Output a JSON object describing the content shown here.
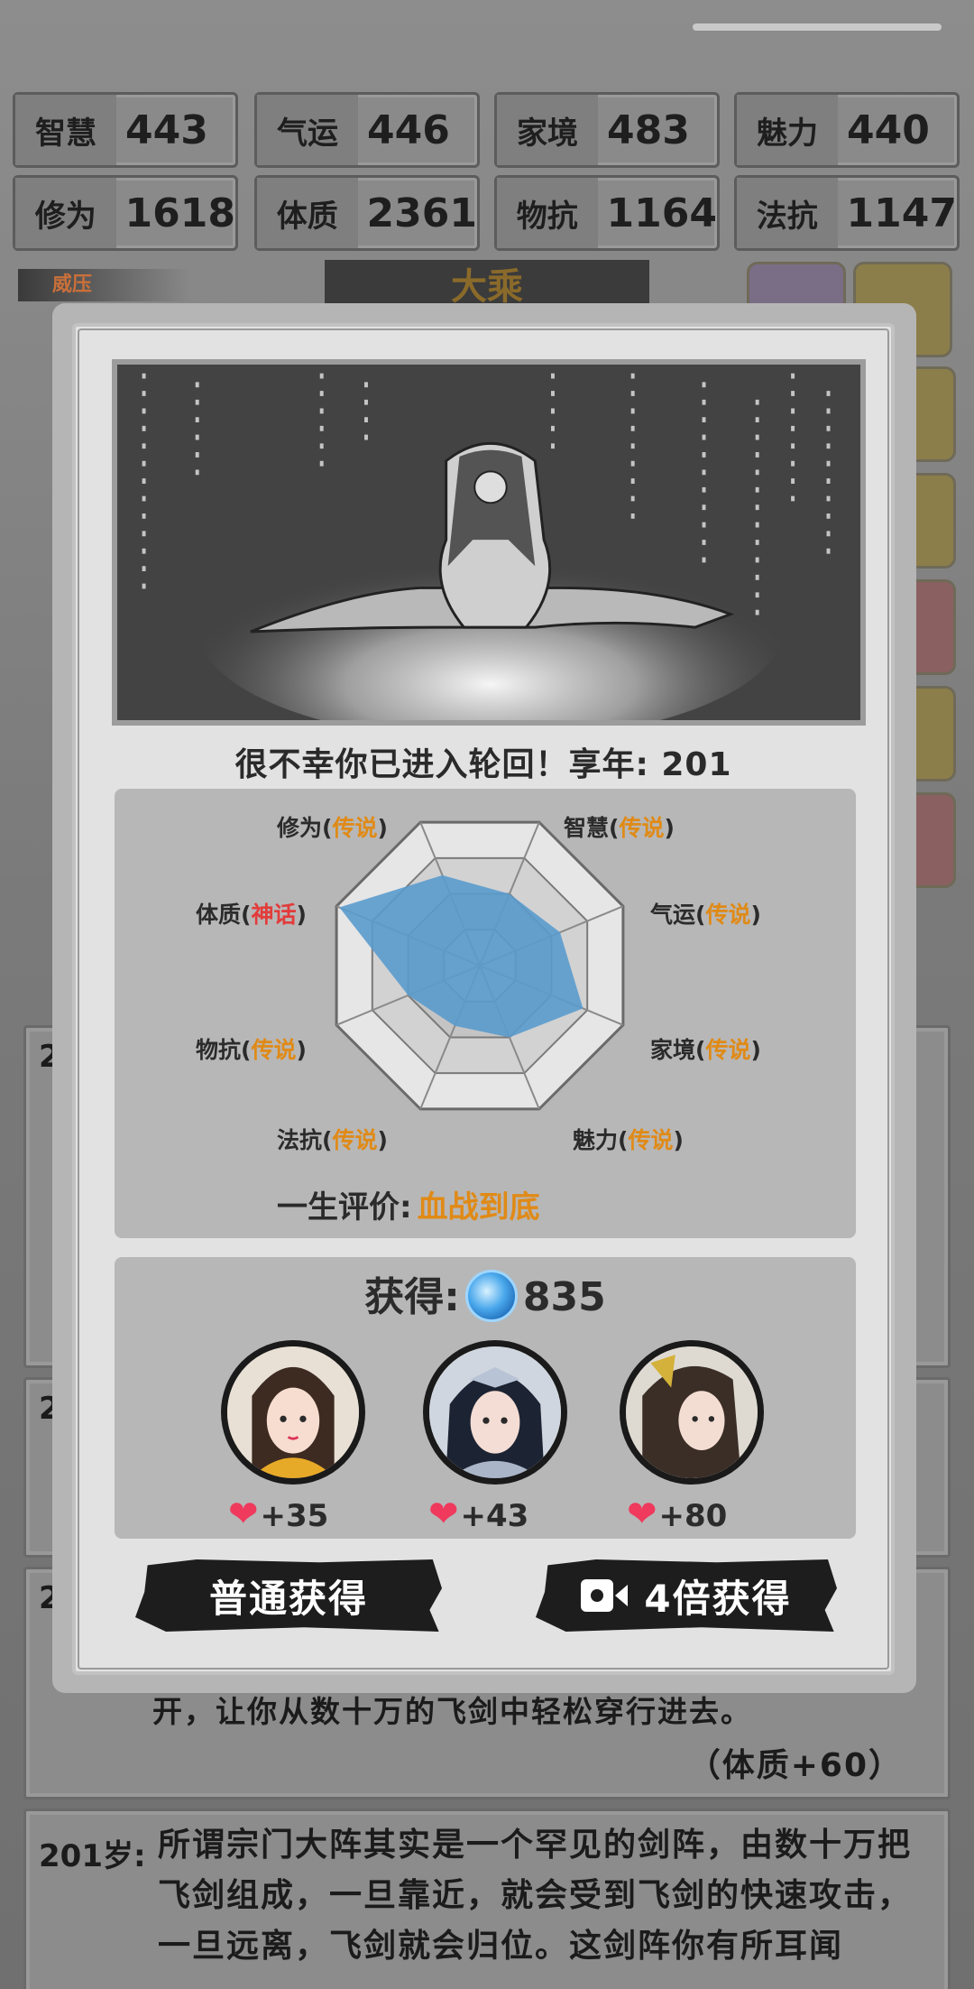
{
  "stats": [
    {
      "label": "智慧",
      "value": "443"
    },
    {
      "label": "气运",
      "value": "446"
    },
    {
      "label": "家境",
      "value": "483"
    },
    {
      "label": "魅力",
      "value": "440"
    },
    {
      "label": "修为",
      "value": "1618"
    },
    {
      "label": "体质",
      "value": "2361"
    },
    {
      "label": "物抗",
      "value": "1164"
    },
    {
      "label": "法抗",
      "value": "1147"
    }
  ],
  "background": {
    "side_tab_label": "威压",
    "title": "大乘",
    "log_age_prefix": "2",
    "log_partial_line": "开，让你从数十万的飞剑中轻松穿行进去。",
    "log_reward": "（体质+60）",
    "last_entry": {
      "age": "201岁:",
      "text": "所谓宗门大阵其实是一个罕见的剑阵，由数十万把飞剑组成，一旦靠近，就会受到飞剑的快速攻击，一旦远离，飞剑就会归位。这剑阵你有所耳闻"
    }
  },
  "modal": {
    "death_message": "很不幸你已进入轮回！享年: 201",
    "radar": {
      "axes": [
        {
          "name": "修为",
          "rank": "传说"
        },
        {
          "name": "智慧",
          "rank": "传说"
        },
        {
          "name": "气运",
          "rank": "传说"
        },
        {
          "name": "家境",
          "rank": "传说"
        },
        {
          "name": "魅力",
          "rank": "传说"
        },
        {
          "name": "法抗",
          "rank": "传说"
        },
        {
          "name": "物抗",
          "rank": "传说"
        },
        {
          "name": "体质",
          "rank": "神话"
        }
      ],
      "values": [
        0.63,
        0.5,
        0.56,
        0.72,
        0.5,
        0.42,
        0.5,
        0.98
      ],
      "fill_color": "#5a9bcd",
      "grid_levels": 4
    },
    "life_eval_label": "一生评价:",
    "life_eval_value": "血战到底",
    "reward_label": "获得:",
    "reward_amount": "835",
    "companions": [
      {
        "name": "companion-1",
        "affection": "+35"
      },
      {
        "name": "companion-2",
        "affection": "+43"
      },
      {
        "name": "companion-3",
        "affection": "+80"
      }
    ],
    "buttons": {
      "normal": "普通获得",
      "ad": "4倍获得"
    }
  }
}
